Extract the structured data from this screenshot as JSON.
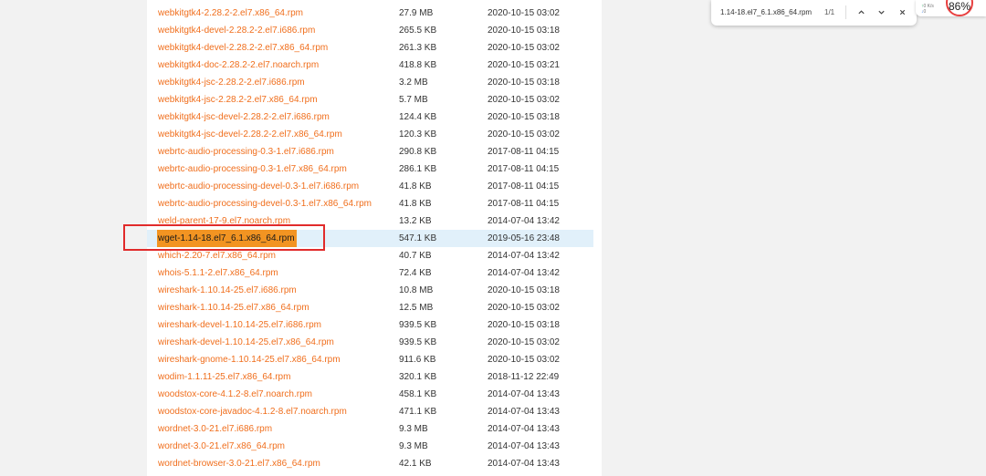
{
  "files": [
    {
      "name": "webkitgtk4-2.28.2-2.el7.x86_64.rpm",
      "size": "27.9 MB",
      "date": "2020-10-15 03:02"
    },
    {
      "name": "webkitgtk4-devel-2.28.2-2.el7.i686.rpm",
      "size": "265.5 KB",
      "date": "2020-10-15 03:18"
    },
    {
      "name": "webkitgtk4-devel-2.28.2-2.el7.x86_64.rpm",
      "size": "261.3 KB",
      "date": "2020-10-15 03:02"
    },
    {
      "name": "webkitgtk4-doc-2.28.2-2.el7.noarch.rpm",
      "size": "418.8 KB",
      "date": "2020-10-15 03:21"
    },
    {
      "name": "webkitgtk4-jsc-2.28.2-2.el7.i686.rpm",
      "size": "3.2 MB",
      "date": "2020-10-15 03:18"
    },
    {
      "name": "webkitgtk4-jsc-2.28.2-2.el7.x86_64.rpm",
      "size": "5.7 MB",
      "date": "2020-10-15 03:02"
    },
    {
      "name": "webkitgtk4-jsc-devel-2.28.2-2.el7.i686.rpm",
      "size": "124.4 KB",
      "date": "2020-10-15 03:18"
    },
    {
      "name": "webkitgtk4-jsc-devel-2.28.2-2.el7.x86_64.rpm",
      "size": "120.3 KB",
      "date": "2020-10-15 03:02"
    },
    {
      "name": "webrtc-audio-processing-0.3-1.el7.i686.rpm",
      "size": "290.8 KB",
      "date": "2017-08-11 04:15"
    },
    {
      "name": "webrtc-audio-processing-0.3-1.el7.x86_64.rpm",
      "size": "286.1 KB",
      "date": "2017-08-11 04:15"
    },
    {
      "name": "webrtc-audio-processing-devel-0.3-1.el7.i686.rpm",
      "size": "41.8 KB",
      "date": "2017-08-11 04:15"
    },
    {
      "name": "webrtc-audio-processing-devel-0.3-1.el7.x86_64.rpm",
      "size": "41.8 KB",
      "date": "2017-08-11 04:15"
    },
    {
      "name": "weld-parent-17-9.el7.noarch.rpm",
      "size": "13.2 KB",
      "date": "2014-07-04 13:42"
    },
    {
      "name": "wget-1.14-18.el7_6.1.x86_64.rpm",
      "size": "547.1 KB",
      "date": "2019-05-16 23:48",
      "highlighted": true
    },
    {
      "name": "which-2.20-7.el7.x86_64.rpm",
      "size": "40.7 KB",
      "date": "2014-07-04 13:42"
    },
    {
      "name": "whois-5.1.1-2.el7.x86_64.rpm",
      "size": "72.4 KB",
      "date": "2014-07-04 13:42"
    },
    {
      "name": "wireshark-1.10.14-25.el7.i686.rpm",
      "size": "10.8 MB",
      "date": "2020-10-15 03:18"
    },
    {
      "name": "wireshark-1.10.14-25.el7.x86_64.rpm",
      "size": "12.5 MB",
      "date": "2020-10-15 03:02"
    },
    {
      "name": "wireshark-devel-1.10.14-25.el7.i686.rpm",
      "size": "939.5 KB",
      "date": "2020-10-15 03:18"
    },
    {
      "name": "wireshark-devel-1.10.14-25.el7.x86_64.rpm",
      "size": "939.5 KB",
      "date": "2020-10-15 03:02"
    },
    {
      "name": "wireshark-gnome-1.10.14-25.el7.x86_64.rpm",
      "size": "911.6 KB",
      "date": "2020-10-15 03:02"
    },
    {
      "name": "wodim-1.1.11-25.el7.x86_64.rpm",
      "size": "320.1 KB",
      "date": "2018-11-12 22:49"
    },
    {
      "name": "woodstox-core-4.1.2-8.el7.noarch.rpm",
      "size": "458.1 KB",
      "date": "2014-07-04 13:43"
    },
    {
      "name": "woodstox-core-javadoc-4.1.2-8.el7.noarch.rpm",
      "size": "471.1 KB",
      "date": "2014-07-04 13:43"
    },
    {
      "name": "wordnet-3.0-21.el7.i686.rpm",
      "size": "9.3 MB",
      "date": "2014-07-04 13:43"
    },
    {
      "name": "wordnet-3.0-21.el7.x86_64.rpm",
      "size": "9.3 MB",
      "date": "2014-07-04 13:43"
    },
    {
      "name": "wordnet-browser-3.0-21.el7.x86_64.rpm",
      "size": "42.1 KB",
      "date": "2014-07-04 13:43"
    }
  ],
  "find_bar": {
    "query": "1.14-18.el7_6.1.x86_64.rpm",
    "count": "1/1",
    "prev_icon": "chevron-up-icon",
    "next_icon": "chevron-down-icon",
    "close_icon": "close-icon"
  },
  "net_widget": {
    "up_arrow": "↑",
    "up_value": "0",
    "down_arrow": "↓",
    "down_value": "0",
    "unit": "K/s",
    "cpu_percent": "86%"
  },
  "colors": {
    "link": "#f06e1c",
    "row_highlight": "#e1f0fa",
    "find_match": "#f29422",
    "annotation_box": "#e12b2b"
  }
}
